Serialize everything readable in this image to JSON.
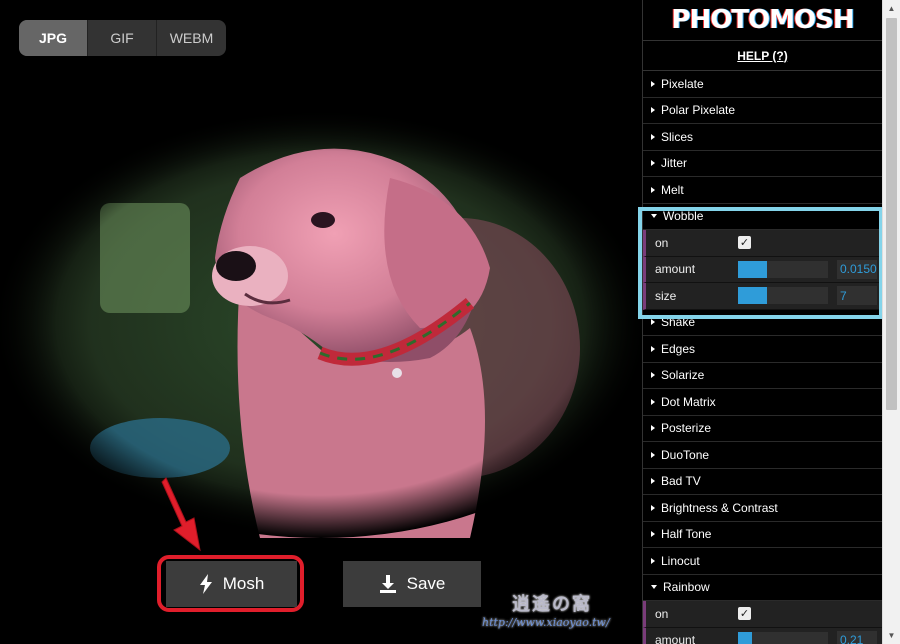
{
  "format_tabs": [
    {
      "label": "JPG",
      "active": true
    },
    {
      "label": "GIF",
      "active": false
    },
    {
      "label": "WEBM",
      "active": false
    }
  ],
  "actions": {
    "mosh_label": "Mosh",
    "mosh_icon": "lightning-bolt-icon",
    "save_label": "Save",
    "save_icon": "download-icon"
  },
  "panel": {
    "logo": "PHOTOMOSH",
    "help_label": "HELP (?)",
    "effects_before": [
      "Pixelate",
      "Polar Pixelate",
      "Slices",
      "Jitter",
      "Melt"
    ],
    "wobble": {
      "label": "Wobble",
      "on_label": "on",
      "on_checked": true,
      "amount_label": "amount",
      "amount_value": "0.0150",
      "amount_fraction": 0.32,
      "size_label": "size",
      "size_value": "7",
      "size_fraction": 0.32
    },
    "effects_after": [
      "Shake",
      "Edges",
      "Solarize",
      "Dot Matrix",
      "Posterize",
      "DuoTone",
      "Bad TV",
      "Brightness & Contrast",
      "Half Tone",
      "Linocut"
    ],
    "rainbow": {
      "label": "Rainbow",
      "on_label": "on",
      "on_checked": true,
      "amount_label": "amount",
      "amount_value": "0.21",
      "amount_fraction": 0.15
    }
  },
  "watermark": {
    "logo_text": "逍遙の窩",
    "url": "http://www.xiaoyao.tw/"
  },
  "colors": {
    "accent_blue": "#2f9cd9",
    "highlight_red": "#e01e2b",
    "highlight_cyan": "#84d4ea"
  }
}
